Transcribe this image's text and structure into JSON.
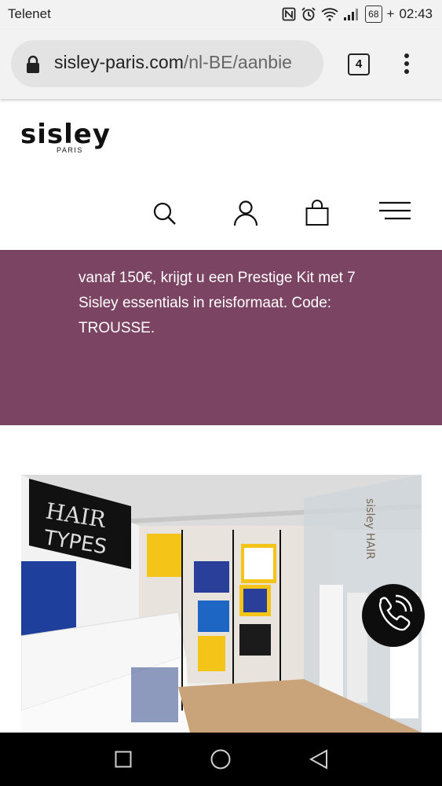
{
  "status_bar": {
    "carrier": "Telenet",
    "battery": "68",
    "time": "02:43",
    "icons": [
      "nfc-icon",
      "alarm-icon",
      "wifi-icon",
      "signal-icon",
      "battery-icon"
    ]
  },
  "browser": {
    "url_host": "sisley-paris.com",
    "url_path": "/nl-BE/aanbie",
    "tab_count": "4",
    "icons": [
      "lock-icon",
      "tabs-icon",
      "menu-kebab-icon"
    ]
  },
  "site": {
    "brand": "sisley",
    "brand_sub": "PARIS",
    "nav_icons": [
      "search-icon",
      "account-icon",
      "cart-icon",
      "hamburger-menu-icon"
    ]
  },
  "promo": {
    "text": "vanaf 150€, krijgt u een Prestige Kit met 7 Sisley essentials in reisformaat. Code: TROUSSE.",
    "background": "#7c4463"
  },
  "hero": {
    "sign_text": "HAIR TYPES"
  },
  "call_button": {
    "icon": "phone-icon"
  },
  "android_nav": {
    "icons": [
      "recents-icon",
      "home-icon",
      "back-icon"
    ]
  }
}
